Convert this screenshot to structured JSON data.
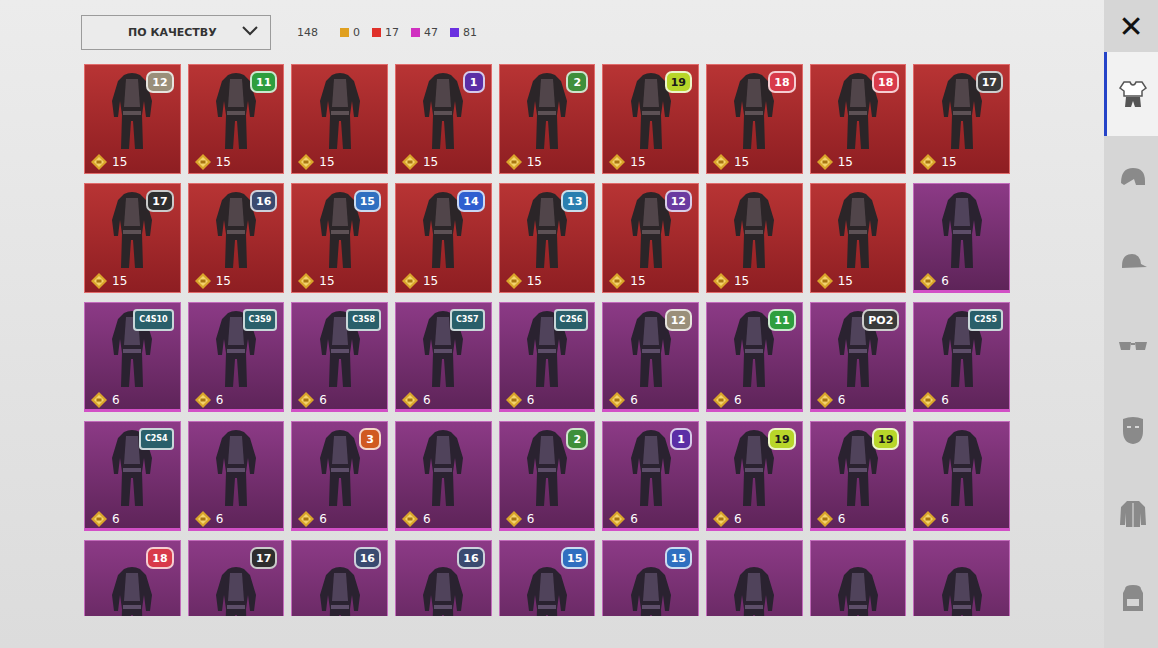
{
  "sort_dropdown": {
    "label": "ПО КАЧЕСТВУ"
  },
  "total": "148",
  "counters": [
    {
      "value": "0",
      "color": "#e0a020"
    },
    {
      "value": "17",
      "color": "#e0302a"
    },
    {
      "value": "47",
      "color": "#d030c0"
    },
    {
      "value": "81",
      "color": "#6a30e0"
    }
  ],
  "close": "✕",
  "sidebar": {
    "tabs": [
      {
        "selected": true
      },
      {
        "selected": false
      },
      {
        "selected": false
      },
      {
        "selected": false
      },
      {
        "selected": false
      },
      {
        "selected": false
      },
      {
        "selected": false
      }
    ]
  },
  "grid": {
    "items": [
      {
        "kind": "legendary",
        "badge": {
          "text": "12",
          "color": "#9a8f7a"
        },
        "cost": "15"
      },
      {
        "kind": "legendary",
        "badge": {
          "text": "11",
          "color": "#2e9e3e"
        },
        "cost": "15"
      },
      {
        "kind": "legendary",
        "cost": "15"
      },
      {
        "kind": "legendary",
        "badge": {
          "text": "1",
          "color": "#5b2ea6"
        },
        "cost": "15"
      },
      {
        "kind": "legendary",
        "badge": {
          "text": "2",
          "color": "#3f8f3a"
        },
        "cost": "15"
      },
      {
        "kind": "legendary",
        "badge": {
          "text": "19",
          "color": "#b8d62a"
        },
        "cost": "15"
      },
      {
        "kind": "legendary",
        "badge": {
          "text": "18",
          "color": "#d83a4a"
        },
        "cost": "15"
      },
      {
        "kind": "legendary",
        "badge": {
          "text": "18",
          "color": "#d83a4a"
        },
        "cost": "15"
      },
      {
        "kind": "legendary",
        "badge": {
          "text": "17",
          "color": "#3a3a3a"
        },
        "cost": "15"
      },
      {
        "kind": "legendary",
        "badge": {
          "text": "17",
          "color": "#2e2e2e"
        },
        "cost": "15"
      },
      {
        "kind": "legendary",
        "badge": {
          "text": "16",
          "color": "#3a4a70"
        },
        "cost": "15"
      },
      {
        "kind": "legendary",
        "badge": {
          "text": "15",
          "color": "#2f6fc0"
        },
        "cost": "15"
      },
      {
        "kind": "legendary",
        "badge": {
          "text": "14",
          "color": "#2f5fd0"
        },
        "cost": "15"
      },
      {
        "kind": "legendary",
        "badge": {
          "text": "13",
          "color": "#2a7fb0"
        },
        "cost": "15"
      },
      {
        "kind": "legendary",
        "badge": {
          "text": "12",
          "color": "#6a3aa0"
        },
        "cost": "15"
      },
      {
        "kind": "legendary",
        "cost": "15"
      },
      {
        "kind": "legendary",
        "cost": "15"
      },
      {
        "kind": "epic",
        "cost": "6"
      },
      {
        "kind": "epic",
        "badge": {
          "text": "C4S10",
          "color": "#2a5f6a"
        },
        "cost": "6"
      },
      {
        "kind": "epic",
        "badge": {
          "text": "C3S9",
          "color": "#2a5f6a"
        },
        "cost": "6"
      },
      {
        "kind": "epic",
        "badge": {
          "text": "C3S8",
          "color": "#2a5f6a"
        },
        "cost": "6"
      },
      {
        "kind": "epic",
        "badge": {
          "text": "C3S7",
          "color": "#2a5f6a"
        },
        "cost": "6"
      },
      {
        "kind": "epic",
        "badge": {
          "text": "C2S6",
          "color": "#2a5f6a"
        },
        "cost": "6"
      },
      {
        "kind": "epic",
        "badge": {
          "text": "12",
          "color": "#9a8f7a"
        },
        "cost": "6"
      },
      {
        "kind": "epic",
        "badge": {
          "text": "11",
          "color": "#2e9e3e"
        },
        "cost": "6"
      },
      {
        "kind": "epic",
        "badge": {
          "text": "PO2",
          "color": "#3a3a3a"
        },
        "cost": "6"
      },
      {
        "kind": "epic",
        "badge": {
          "text": "C2S5",
          "color": "#2a5f6a"
        },
        "cost": "6"
      },
      {
        "kind": "epic",
        "badge": {
          "text": "C2S4",
          "color": "#2a5f6a"
        },
        "cost": "6"
      },
      {
        "kind": "epic",
        "cost": "6"
      },
      {
        "kind": "epic",
        "badge": {
          "text": "3",
          "color": "#d05a20"
        },
        "cost": "6"
      },
      {
        "kind": "epic",
        "cost": "6"
      },
      {
        "kind": "epic",
        "badge": {
          "text": "2",
          "color": "#3f8f3a"
        },
        "cost": "6"
      },
      {
        "kind": "epic",
        "badge": {
          "text": "1",
          "color": "#5b2ea6"
        },
        "cost": "6"
      },
      {
        "kind": "epic",
        "badge": {
          "text": "19",
          "color": "#b8d62a"
        },
        "cost": "6"
      },
      {
        "kind": "epic",
        "badge": {
          "text": "19",
          "color": "#b8d62a"
        },
        "cost": "6"
      },
      {
        "kind": "epic",
        "cost": "6"
      },
      {
        "kind": "epic",
        "badge": {
          "text": "18",
          "color": "#d83a4a"
        }
      },
      {
        "kind": "epic",
        "badge": {
          "text": "17",
          "color": "#2e2e2e"
        }
      },
      {
        "kind": "epic",
        "badge": {
          "text": "16",
          "color": "#3a4a70"
        }
      },
      {
        "kind": "epic",
        "badge": {
          "text": "16",
          "color": "#3a4a70"
        }
      },
      {
        "kind": "epic",
        "badge": {
          "text": "15",
          "color": "#2f6fc0"
        }
      },
      {
        "kind": "epic",
        "badge": {
          "text": "15",
          "color": "#2f6fc0"
        }
      },
      {
        "kind": "epic"
      },
      {
        "kind": "epic"
      },
      {
        "kind": "epic"
      }
    ]
  }
}
